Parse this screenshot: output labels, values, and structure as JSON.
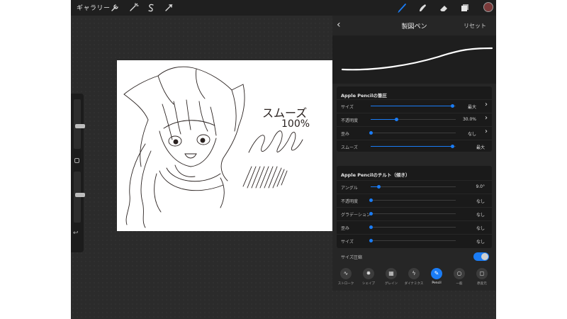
{
  "topbar": {
    "gallery_label": "ギャラリー",
    "left_tools": [
      "wrench-icon",
      "magic-wand-icon",
      "selection-icon",
      "transform-icon"
    ],
    "right_tools": [
      "brush-icon",
      "smudge-icon",
      "eraser-icon",
      "layers-icon"
    ],
    "active_tool": "brush-icon",
    "current_color": "#7a3a3a"
  },
  "sidebar": {
    "brush_size_level": 0.45,
    "opacity_level": 0.55,
    "undo_label": "↩"
  },
  "canvas": {
    "handwriting_line1": "スムーズ",
    "handwriting_line2": "100%"
  },
  "brush_panel": {
    "back_label": "‹",
    "title": "製図ペン",
    "reset_label": "リセット",
    "pressure": {
      "title": "Apple Pencilの筆圧",
      "rows": [
        {
          "label": "サイズ",
          "value": "最大",
          "level": 0.96,
          "chevron": "›"
        },
        {
          "label": "不透明度",
          "value": "30.0%",
          "level": 0.3,
          "chevron": "›"
        },
        {
          "label": "歪み",
          "value": "なし",
          "level": 0.0,
          "chevron": "›"
        },
        {
          "label": "スムーズ",
          "value": "最大",
          "level": 0.96,
          "chevron": ""
        }
      ]
    },
    "tilt": {
      "title": "Apple Pencilのチルト（傾き）",
      "rows": [
        {
          "label": "アングル",
          "value": "9.0°",
          "level": 0.09
        },
        {
          "label": "不透明度",
          "value": "なし",
          "level": 0.0
        },
        {
          "label": "グラデーション",
          "value": "なし",
          "level": 0.0
        },
        {
          "label": "歪み",
          "value": "なし",
          "level": 0.0
        },
        {
          "label": "サイズ",
          "value": "なし",
          "level": 0.0
        }
      ]
    },
    "size_limit": {
      "label": "サイズ圧縮",
      "on": true
    },
    "tabs": [
      {
        "label": "ストローク",
        "icon": "stroke-icon",
        "glyph": "∿"
      },
      {
        "label": "シェイプ",
        "icon": "shape-icon",
        "glyph": "✸"
      },
      {
        "label": "グレイン",
        "icon": "grain-icon",
        "glyph": "▦"
      },
      {
        "label": "ダイナミクス",
        "icon": "dynamics-icon",
        "glyph": "ϟ"
      },
      {
        "label": "Pencil",
        "icon": "pencil-icon",
        "glyph": "✎",
        "active": true
      },
      {
        "label": "一般",
        "icon": "general-icon",
        "glyph": "○"
      },
      {
        "label": "原産元",
        "icon": "source-icon",
        "glyph": "◻"
      }
    ],
    "accent_color": "#1a7cf5"
  }
}
